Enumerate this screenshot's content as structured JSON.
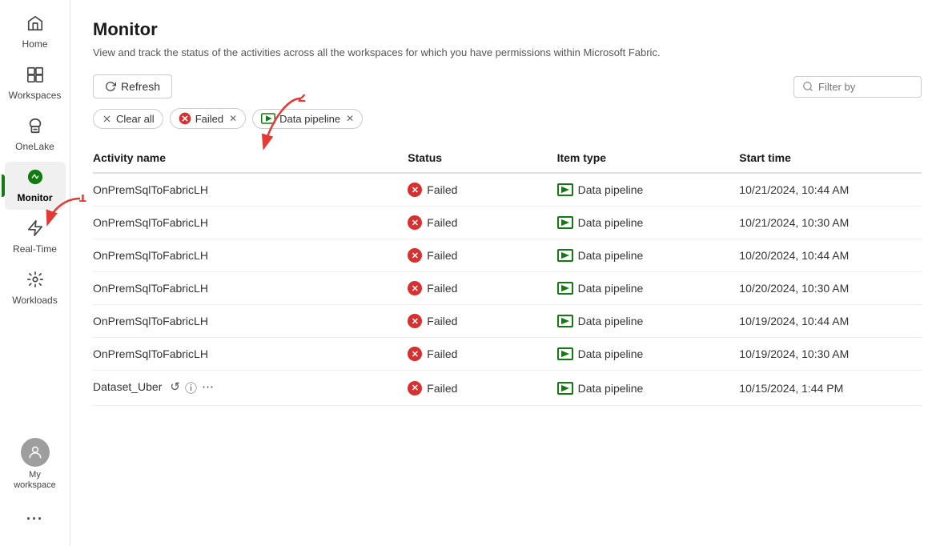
{
  "sidebar": {
    "items": [
      {
        "id": "home",
        "label": "Home",
        "icon": "🏠",
        "active": false
      },
      {
        "id": "workspaces",
        "label": "Workspaces",
        "icon": "🗂",
        "active": false
      },
      {
        "id": "onelake",
        "label": "OneLake",
        "icon": "☁",
        "active": false
      },
      {
        "id": "monitor",
        "label": "Monitor",
        "icon": "●",
        "active": true
      },
      {
        "id": "realtime",
        "label": "Real-Time",
        "icon": "⚡",
        "active": false
      },
      {
        "id": "workloads",
        "label": "Workloads",
        "icon": "⊞",
        "active": false
      }
    ],
    "my_workspace_label": "My workspace",
    "more_label": "..."
  },
  "header": {
    "title": "Monitor",
    "subtitle": "View and track the status of the activities across all the workspaces for which you have permissions within Microsoft Fabric."
  },
  "toolbar": {
    "refresh_label": "Refresh"
  },
  "filters": {
    "clear_all_label": "Clear all",
    "chips": [
      {
        "id": "failed",
        "label": "Failed",
        "has_icon": true,
        "icon_color": "#d92f2f"
      },
      {
        "id": "data_pipeline",
        "label": "Data pipeline",
        "has_icon": true
      }
    ],
    "filter_placeholder": "Filter by"
  },
  "table": {
    "columns": [
      {
        "id": "activity_name",
        "label": "Activity name"
      },
      {
        "id": "status",
        "label": "Status"
      },
      {
        "id": "item_type",
        "label": "Item type"
      },
      {
        "id": "start_time",
        "label": "Start time"
      }
    ],
    "rows": [
      {
        "id": 1,
        "activity_name": "OnPremSqlToFabricLH",
        "status": "Failed",
        "item_type": "Data pipeline",
        "start_time": "10/21/2024, 10:44 AM",
        "actions": false
      },
      {
        "id": 2,
        "activity_name": "OnPremSqlToFabricLH",
        "status": "Failed",
        "item_type": "Data pipeline",
        "start_time": "10/21/2024, 10:30 AM",
        "actions": false
      },
      {
        "id": 3,
        "activity_name": "OnPremSqlToFabricLH",
        "status": "Failed",
        "item_type": "Data pipeline",
        "start_time": "10/20/2024, 10:44 AM",
        "actions": false
      },
      {
        "id": 4,
        "activity_name": "OnPremSqlToFabricLH",
        "status": "Failed",
        "item_type": "Data pipeline",
        "start_time": "10/20/2024, 10:30 AM",
        "actions": false
      },
      {
        "id": 5,
        "activity_name": "OnPremSqlToFabricLH",
        "status": "Failed",
        "item_type": "Data pipeline",
        "start_time": "10/19/2024, 10:44 AM",
        "actions": false
      },
      {
        "id": 6,
        "activity_name": "OnPremSqlToFabricLH",
        "status": "Failed",
        "item_type": "Data pipeline",
        "start_time": "10/19/2024, 10:30 AM",
        "actions": false
      },
      {
        "id": 7,
        "activity_name": "Dataset_Uber",
        "status": "Failed",
        "item_type": "Data pipeline",
        "start_time": "10/15/2024, 1:44 PM",
        "actions": true
      }
    ]
  },
  "annotation1": "1",
  "annotation2": "2"
}
